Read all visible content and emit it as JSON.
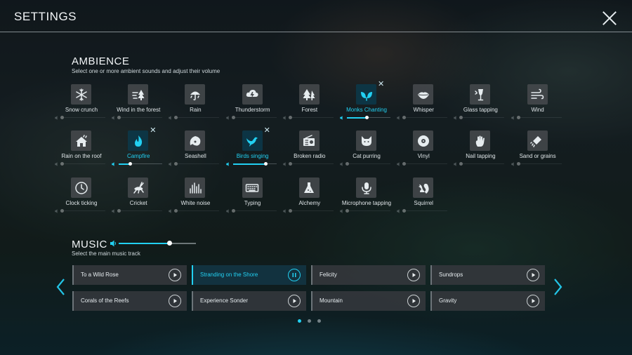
{
  "header": {
    "title": "SETTINGS"
  },
  "ambience": {
    "title": "AMBIENCE",
    "subtitle": "Select one or more ambient sounds and adjust their volume",
    "items": [
      {
        "label": "Snow crunch",
        "icon": "snowflake-icon",
        "active": false,
        "volume": 0
      },
      {
        "label": "Wind in the forest",
        "icon": "wind-forest-icon",
        "active": false,
        "volume": 0
      },
      {
        "label": "Rain",
        "icon": "umbrella-rain-icon",
        "active": false,
        "volume": 0
      },
      {
        "label": "Thunderstorm",
        "icon": "thunder-cloud-icon",
        "active": false,
        "volume": 0
      },
      {
        "label": "Forest",
        "icon": "trees-icon",
        "active": false,
        "volume": 0
      },
      {
        "label": "Monks Chanting",
        "icon": "leaves-icon",
        "active": true,
        "volume": 0.45
      },
      {
        "label": "Whisper",
        "icon": "lips-icon",
        "active": false,
        "volume": 0
      },
      {
        "label": "Glass tapping",
        "icon": "wine-glass-icon",
        "active": false,
        "volume": 0
      },
      {
        "label": "Wind",
        "icon": "wind-icon",
        "active": false,
        "volume": 0
      },
      {
        "label": "Rain on the roof",
        "icon": "house-rain-icon",
        "active": false,
        "volume": 0
      },
      {
        "label": "Campfire",
        "icon": "flame-icon",
        "active": true,
        "volume": 0.25
      },
      {
        "label": "Seashell",
        "icon": "seashell-icon",
        "active": false,
        "volume": 0
      },
      {
        "label": "Birds singing",
        "icon": "bird-icon",
        "active": true,
        "volume": 0.75
      },
      {
        "label": "Broken radio",
        "icon": "radio-icon",
        "active": false,
        "volume": 0
      },
      {
        "label": "Cat purring",
        "icon": "cat-icon",
        "active": false,
        "volume": 0
      },
      {
        "label": "Vinyl",
        "icon": "vinyl-icon",
        "active": false,
        "volume": 0
      },
      {
        "label": "Nail tapping",
        "icon": "hand-tap-icon",
        "active": false,
        "volume": 0
      },
      {
        "label": "Sand or grains",
        "icon": "sand-icon",
        "active": false,
        "volume": 0
      },
      {
        "label": "Clock ticking",
        "icon": "clock-icon",
        "active": false,
        "volume": 0
      },
      {
        "label": "Cricket",
        "icon": "cricket-icon",
        "active": false,
        "volume": 0
      },
      {
        "label": "White noise",
        "icon": "equalizer-icon",
        "active": false,
        "volume": 0
      },
      {
        "label": "Typing",
        "icon": "keyboard-icon",
        "active": false,
        "volume": 0
      },
      {
        "label": "Alchemy",
        "icon": "flask-icon",
        "active": false,
        "volume": 0
      },
      {
        "label": "Microphone tapping",
        "icon": "microphone-icon",
        "active": false,
        "volume": 0
      },
      {
        "label": "Squirrel",
        "icon": "squirrel-icon",
        "active": false,
        "volume": 0
      }
    ]
  },
  "music": {
    "title": "MUSIC",
    "subtitle": "Select the main music track",
    "volume": 0.65,
    "tracks": [
      {
        "name": "To a Wild Rose",
        "playing": false
      },
      {
        "name": "Stranding on the Shore",
        "playing": true
      },
      {
        "name": "Felicity",
        "playing": false
      },
      {
        "name": "Sundrops",
        "playing": false
      },
      {
        "name": "Corals of the Reefs",
        "playing": false
      },
      {
        "name": "Experience Sonder",
        "playing": false
      },
      {
        "name": "Mountain",
        "playing": false
      },
      {
        "name": "Gravity",
        "playing": false
      }
    ],
    "pages": 3,
    "current_page": 1
  },
  "colors": {
    "accent": "#22d0f2",
    "text": "#e8eef2",
    "tile": "#464a4e"
  }
}
